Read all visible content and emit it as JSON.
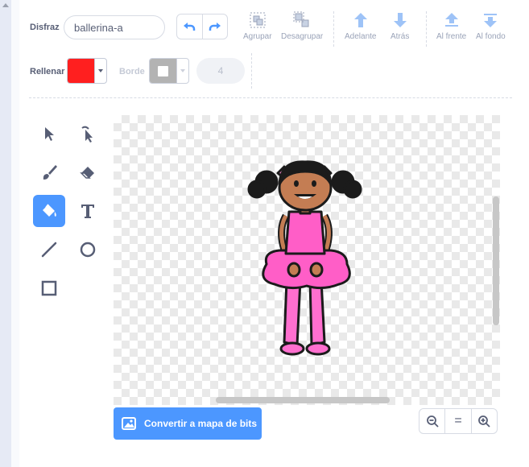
{
  "costume": {
    "label": "Disfraz",
    "name": "ballerina-a"
  },
  "toolbar": {
    "group": "Agrupar",
    "ungroup": "Desagrupar",
    "forward": "Adelante",
    "backward": "Atrás",
    "front": "Al frente",
    "back": "Al fondo"
  },
  "fill": {
    "label": "Rellenar",
    "color": "#ff1f1f"
  },
  "outline": {
    "label": "Borde",
    "color": "#a6a6a6",
    "width": "4"
  },
  "tools": [
    "select-tool",
    "reshape-tool",
    "brush-tool",
    "eraser-tool",
    "fill-tool",
    "text-tool",
    "line-tool",
    "circle-tool",
    "rectangle-tool"
  ],
  "selected_tool": "fill-tool",
  "convert_button": "Convertir a mapa de bits",
  "zoom": {
    "out": "zoom-out-icon",
    "reset": "=",
    "in": "zoom-in-icon"
  },
  "colors": {
    "accent": "#4c97ff",
    "tutu": "#ff5ec7",
    "skin": "#c47d53"
  }
}
